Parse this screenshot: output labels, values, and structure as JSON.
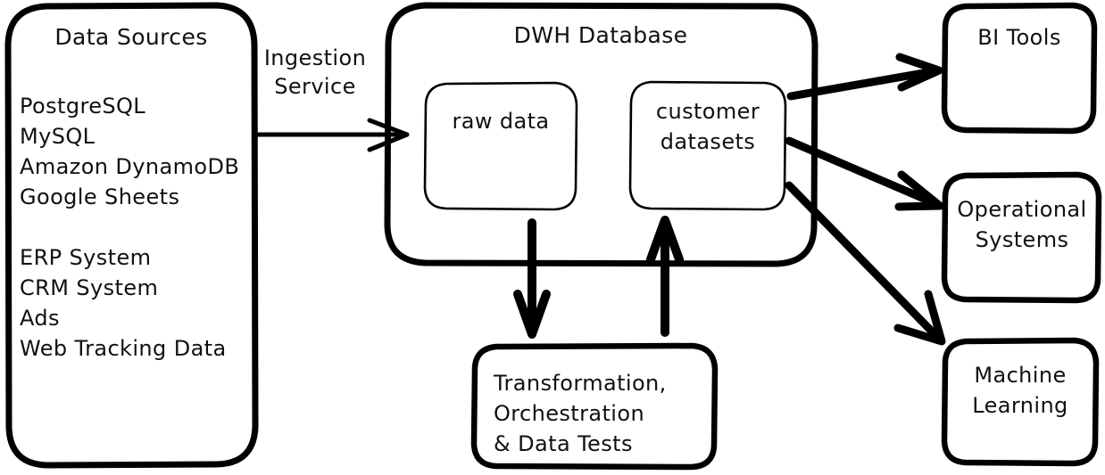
{
  "diagram": {
    "type": "data-warehouse-architecture-flowchart",
    "style": "hand-drawn-sketch",
    "background_color": "#ffffff",
    "stroke_color": "#000000",
    "nodes": {
      "data_sources": {
        "title": "Data Sources",
        "items_group_1": [
          "PostgreSQL",
          "MySQL",
          "Amazon DynamoDB",
          "Google Sheets"
        ],
        "items_group_2": [
          "ERP System",
          "CRM System",
          "Ads",
          "Web Tracking Data"
        ]
      },
      "dwh_database": {
        "title": "DWH Database",
        "inner": {
          "raw_data": "raw data",
          "customer_datasets_line1": "customer",
          "customer_datasets_line2": "datasets"
        }
      },
      "transformation": {
        "line1": "Transformation,",
        "line2": "Orchestration",
        "line3": "& Data Tests"
      },
      "bi_tools": {
        "title": "BI Tools"
      },
      "operational_systems": {
        "line1": "Operational",
        "line2": "Systems"
      },
      "machine_learning": {
        "line1": "Machine",
        "line2": "Learning"
      }
    },
    "edges": {
      "ingestion": {
        "label_line1": "Ingestion",
        "label_line2": "Service",
        "from": "data_sources",
        "to": "dwh_database"
      },
      "dwh_to_transformation": {
        "from": "dwh_database",
        "to": "transformation"
      },
      "transformation_to_dwh": {
        "from": "transformation",
        "to": "dwh_database"
      },
      "customer_to_bi": {
        "from": "customer_datasets",
        "to": "bi_tools"
      },
      "customer_to_ops": {
        "from": "customer_datasets",
        "to": "operational_systems"
      },
      "customer_to_ml": {
        "from": "customer_datasets",
        "to": "machine_learning"
      }
    }
  }
}
